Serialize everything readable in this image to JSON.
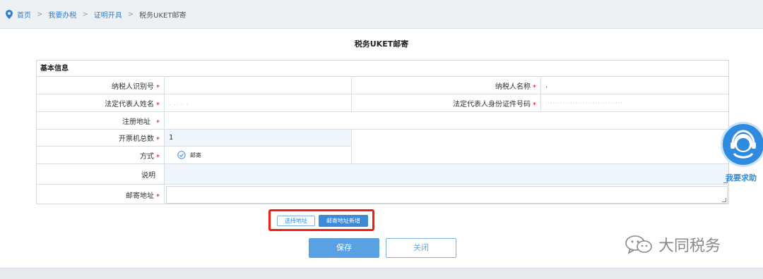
{
  "breadcrumb": {
    "items": [
      "首页",
      "我要办税",
      "证明开具"
    ],
    "current": "税务UKET邮寄",
    "separator": ">"
  },
  "page": {
    "title": "税务UKET邮寄"
  },
  "form": {
    "section_title": "基本信息",
    "required_mark": "*",
    "taxpayer_id_label": "纳税人识别号",
    "taxpayer_name_label": "纳税人名称",
    "taxpayer_name_value": ".",
    "legal_rep_name_label": "法定代表人姓名",
    "legal_rep_name_value": ". .. . .",
    "legal_rep_id_label": "法定代表人身份证件号码",
    "legal_rep_id_value": "·······························",
    "reg_address_label": "注册地址",
    "total_machines_label": "开票机总数",
    "total_machines_value": "1",
    "method_label": "方式",
    "method_option": "邮寄",
    "note_label": "说明",
    "mail_address_label": "邮寄地址"
  },
  "buttons": {
    "select_address": "选择地址",
    "add_mail_address": "邮寄地址新增",
    "save": "保存",
    "close": "关闭"
  },
  "help": {
    "label": "我要求助"
  },
  "watermark": {
    "text": "大同税务"
  },
  "colors": {
    "primary": "#3d8ad8",
    "required": "#e60012",
    "highlight_box": "#f02010"
  }
}
